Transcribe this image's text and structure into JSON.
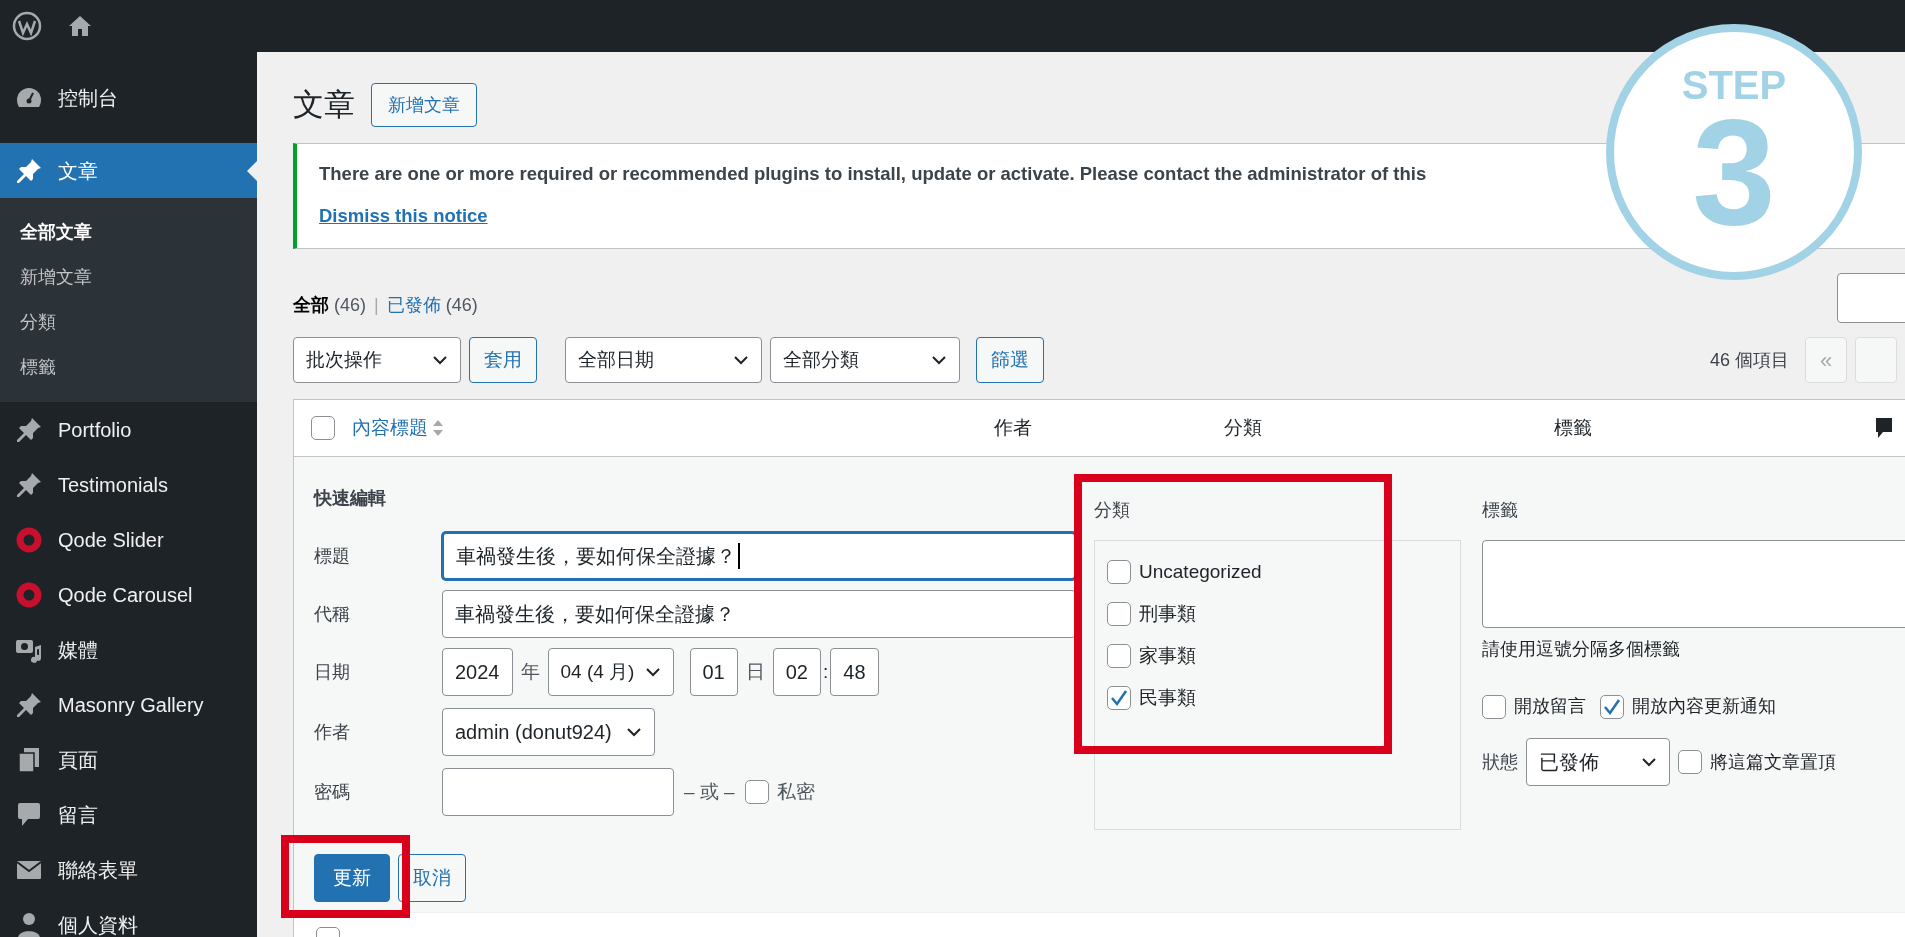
{
  "sidebar": {
    "items": [
      {
        "label": "控制台",
        "kind": "dashboard",
        "selected": false
      },
      {
        "label": "文章",
        "kind": "pin",
        "selected": true,
        "children": [
          {
            "label": "全部文章",
            "selected": true
          },
          {
            "label": "新增文章",
            "selected": false
          },
          {
            "label": "分類",
            "selected": false
          },
          {
            "label": "標籤",
            "selected": false
          }
        ]
      },
      {
        "label": "Portfolio",
        "kind": "pin",
        "selected": false
      },
      {
        "label": "Testimonials",
        "kind": "pin",
        "selected": false
      },
      {
        "label": "Qode Slider",
        "kind": "ring",
        "selected": false
      },
      {
        "label": "Qode Carousel",
        "kind": "ring",
        "selected": false
      },
      {
        "label": "媒體",
        "kind": "media",
        "selected": false
      },
      {
        "label": "Masonry Gallery",
        "kind": "pin",
        "selected": false
      },
      {
        "label": "頁面",
        "kind": "pages",
        "selected": false
      },
      {
        "label": "留言",
        "kind": "comment",
        "selected": false
      },
      {
        "label": "聯絡表單",
        "kind": "mail",
        "selected": false
      },
      {
        "label": "個人資料",
        "kind": "user",
        "selected": false
      }
    ]
  },
  "page_title": "文章",
  "add_new_button": "新增文章",
  "notice": {
    "text": "There are one or more required or recommended plugins to install, update or activate. Please contact the administrator of this",
    "dismiss_link": "Dismiss this notice"
  },
  "views_separator": "|",
  "views": [
    {
      "label": "全部",
      "count": "(46)",
      "selected": true
    },
    {
      "label": "已發佈",
      "count": "(46)",
      "selected": false
    }
  ],
  "filters": {
    "bulk_select": "批次操作",
    "apply_button": "套用",
    "date_select": "全部日期",
    "category_select": "全部分類",
    "filter_button": "篩選"
  },
  "item_count": "46 個項目",
  "pagination": {
    "first": "«"
  },
  "table": {
    "select_all_checked": false,
    "columns": [
      "內容標題",
      "作者",
      "分類",
      "標籤"
    ],
    "next_row": {
      "checked": false
    }
  },
  "quick_edit": {
    "heading": "快速編輯",
    "title": {
      "label": "標題",
      "value": "車禍發生後，要如何保全證據？",
      "focused": true
    },
    "slug": {
      "label": "代稱",
      "value": "車禍發生後，要如何保全證據？"
    },
    "date": {
      "label": "日期",
      "year": "2024",
      "year_unit": "年",
      "month": "04 (4 月)",
      "day": "01",
      "day_unit": "日",
      "hour": "02",
      "separator": ":",
      "minute": "48"
    },
    "author": {
      "label": "作者",
      "value": "admin (donut924)"
    },
    "password": {
      "label": "密碼",
      "or": "– 或 –",
      "private_label": "私密",
      "private_checked": false
    },
    "categories": {
      "heading": "分類",
      "highlighted": true,
      "items": [
        {
          "label": "Uncategorized",
          "checked": false
        },
        {
          "label": "刑事類",
          "checked": false
        },
        {
          "label": "家事類",
          "checked": false
        },
        {
          "label": "民事類",
          "checked": true
        }
      ]
    },
    "tags": {
      "heading": "標籤",
      "hint": "請使用逗號分隔多個標籤"
    },
    "options": [
      {
        "label": "開放留言",
        "checked": false
      },
      {
        "label": "開放內容更新通知",
        "checked": true
      }
    ],
    "status": {
      "label": "狀態",
      "value": "已發佈"
    },
    "sticky": {
      "label": "將這篇文章置頂",
      "checked": false
    },
    "update_button": {
      "label": "更新",
      "highlighted": true
    },
    "cancel_button": "取消"
  },
  "step_badge": {
    "label": "STEP",
    "number": "3"
  }
}
